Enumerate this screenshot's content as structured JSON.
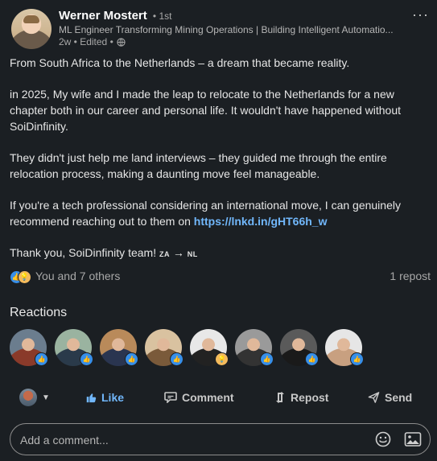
{
  "post": {
    "author_name": "Werner Mostert",
    "degree": "• 1st",
    "headline": "ML Engineer Transforming Mining Operations | Building Intelligent Automatio...",
    "meta": "2w • Edited •",
    "more_label": "···",
    "paragraphs": {
      "p1": "From South Africa to the Netherlands – a dream that became reality.",
      "p2": "in 2025, My wife and I made the leap to relocate to the Netherlands for a new chapter both in our career and personal life. It wouldn't have happened without SoiDinfinity.",
      "p3": "They didn't just help me land interviews – they guided me through the entire relocation process, making a daunting move feel manageable.",
      "p4_prefix": "If you're a tech professional considering an international move, I can genuinely recommend reaching out to them on",
      "p4_link": "https://lnkd.in/gHT66h_w",
      "p5_prefix": "Thank you, SoiDinfinity team!",
      "p5_flag_from": "ZA",
      "p5_arrow": "→",
      "p5_flag_to": "NL"
    }
  },
  "social": {
    "reactions_text": "You and 7 others",
    "reposts_text": "1 repost"
  },
  "reactions": {
    "title": "Reactions",
    "people": [
      {
        "name": "reactor-1",
        "reaction": "like",
        "colors": [
          "#6b7d8e",
          "#8a3a2a"
        ]
      },
      {
        "name": "reactor-2",
        "reaction": "like",
        "colors": [
          "#9ab3a0",
          "#2a3a4a"
        ]
      },
      {
        "name": "reactor-3",
        "reaction": "like",
        "colors": [
          "#b98a5a",
          "#2a3550"
        ]
      },
      {
        "name": "reactor-4",
        "reaction": "like",
        "colors": [
          "#d9c2a0",
          "#7a5a3a"
        ]
      },
      {
        "name": "reactor-5",
        "reaction": "insight",
        "colors": [
          "#e8e8e8",
          "#222222"
        ]
      },
      {
        "name": "reactor-6",
        "reaction": "like",
        "colors": [
          "#9a9a9a",
          "#333333"
        ]
      },
      {
        "name": "reactor-7",
        "reaction": "like",
        "colors": [
          "#5a5a5a",
          "#1a1a1a"
        ]
      },
      {
        "name": "reactor-8",
        "reaction": "like",
        "colors": [
          "#e6e6e6",
          "#c8a080"
        ]
      }
    ]
  },
  "actions": {
    "like": "Like",
    "comment": "Comment",
    "repost": "Repost",
    "send": "Send"
  },
  "comment": {
    "placeholder": "Add a comment..."
  },
  "colors": {
    "background": "#1b1f23",
    "link": "#71b7fb",
    "like_blue": "#378fe9",
    "insight_yellow": "#f5bb5c"
  }
}
